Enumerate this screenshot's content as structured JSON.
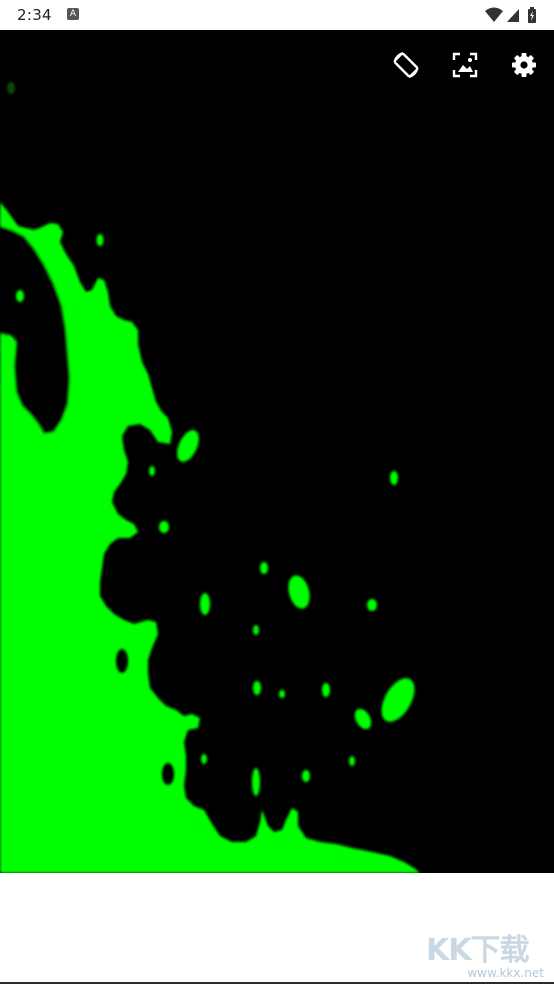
{
  "status_bar": {
    "time": "2:34",
    "notification_icon": "a-notification-icon",
    "icons": [
      "wifi-icon",
      "signal-icon",
      "battery-charging-icon"
    ]
  },
  "toolbar": {
    "buttons": [
      {
        "name": "rotate-screen-button",
        "icon": "screen-rotation-icon"
      },
      {
        "name": "background-image-button",
        "icon": "image-select-icon"
      },
      {
        "name": "settings-button",
        "icon": "gear-icon"
      }
    ]
  },
  "canvas": {
    "background_color": "#000000",
    "fluid_color": "#00ff00",
    "content": "fluid-simulation"
  },
  "watermark": {
    "text": "KK下载",
    "url": "www.kkx.net"
  }
}
